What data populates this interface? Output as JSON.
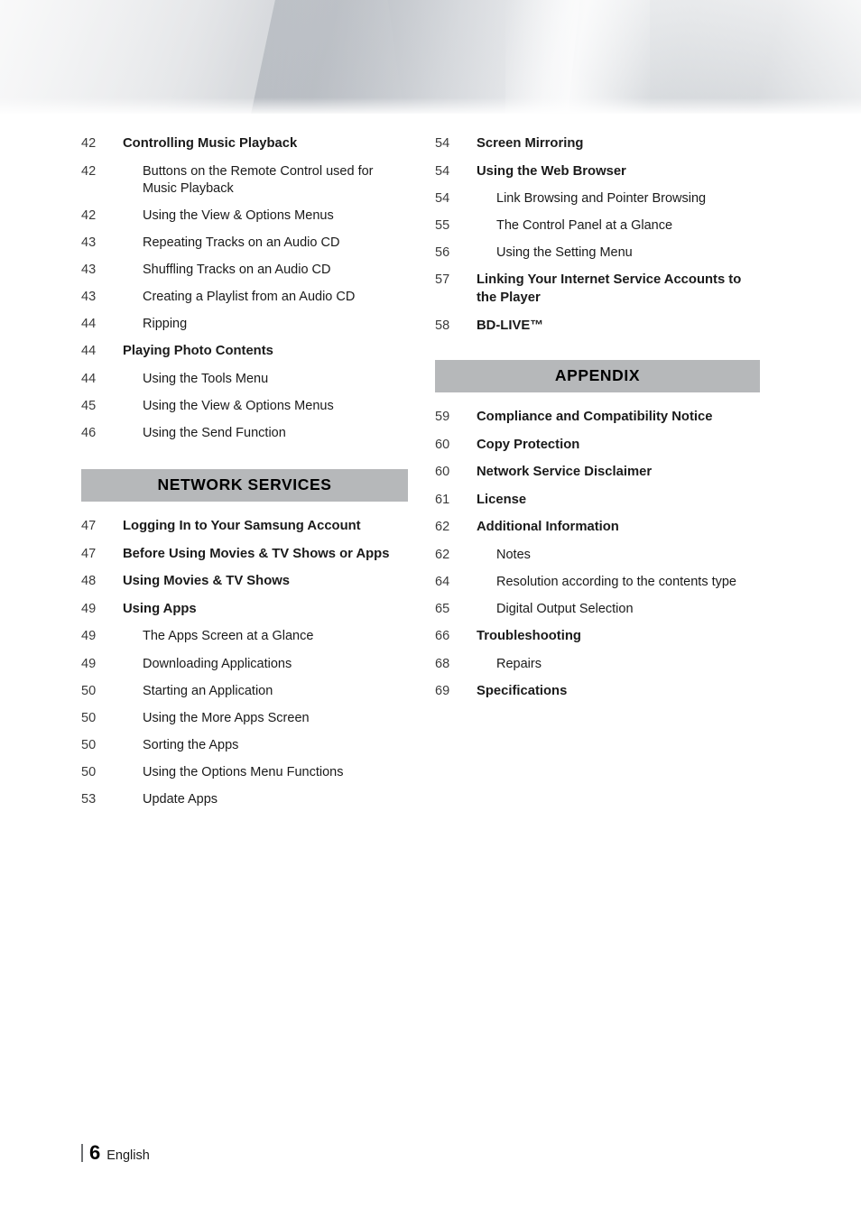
{
  "document": {
    "footer": {
      "page_number": "6",
      "language": "English"
    }
  },
  "toc": {
    "left_column": {
      "entries_top": [
        {
          "page": "42",
          "label": "Controlling Music Playback",
          "level": 1
        },
        {
          "page": "42",
          "label": "Buttons on the Remote Control used for Music Playback",
          "level": 2
        },
        {
          "page": "42",
          "label": "Using the View & Options Menus",
          "level": 2
        },
        {
          "page": "43",
          "label": "Repeating Tracks on an Audio CD",
          "level": 2
        },
        {
          "page": "43",
          "label": "Shuffling Tracks on an Audio CD",
          "level": 2
        },
        {
          "page": "43",
          "label": "Creating a Playlist from an Audio CD",
          "level": 2
        },
        {
          "page": "44",
          "label": "Ripping",
          "level": 2
        },
        {
          "page": "44",
          "label": "Playing Photo Contents",
          "level": 1
        },
        {
          "page": "44",
          "label": "Using the Tools Menu",
          "level": 2
        },
        {
          "page": "45",
          "label": "Using the View & Options Menus",
          "level": 2
        },
        {
          "page": "46",
          "label": "Using the Send Function",
          "level": 2
        }
      ],
      "section_title": "NETWORK SERVICES",
      "entries_bottom": [
        {
          "page": "47",
          "label": "Logging In to Your Samsung Account",
          "level": 1
        },
        {
          "page": "47",
          "label": "Before Using Movies & TV Shows or Apps",
          "level": 1
        },
        {
          "page": "48",
          "label": "Using Movies & TV Shows",
          "level": 1
        },
        {
          "page": "49",
          "label": "Using Apps",
          "level": 1
        },
        {
          "page": "49",
          "label": "The Apps Screen at a Glance",
          "level": 2
        },
        {
          "page": "49",
          "label": "Downloading Applications",
          "level": 2
        },
        {
          "page": "50",
          "label": "Starting an Application",
          "level": 2
        },
        {
          "page": "50",
          "label": "Using the More Apps Screen",
          "level": 2
        },
        {
          "page": "50",
          "label": "Sorting the Apps",
          "level": 2
        },
        {
          "page": "50",
          "label": "Using the Options Menu Functions",
          "level": 2
        },
        {
          "page": "53",
          "label": "Update Apps",
          "level": 2
        }
      ]
    },
    "right_column": {
      "entries_top": [
        {
          "page": "54",
          "label": "Screen Mirroring",
          "level": 1
        },
        {
          "page": "54",
          "label": "Using the Web Browser",
          "level": 1
        },
        {
          "page": "54",
          "label": "Link Browsing and Pointer Browsing",
          "level": 2
        },
        {
          "page": "55",
          "label": "The Control Panel at a Glance",
          "level": 2
        },
        {
          "page": "56",
          "label": "Using the Setting Menu",
          "level": 2
        },
        {
          "page": "57",
          "label": "Linking Your Internet Service Accounts to the Player",
          "level": 1
        },
        {
          "page": "58",
          "label": "BD-LIVE™",
          "level": 1
        }
      ],
      "section_title": "APPENDIX",
      "entries_bottom": [
        {
          "page": "59",
          "label": "Compliance and Compatibility Notice",
          "level": 1
        },
        {
          "page": "60",
          "label": "Copy Protection",
          "level": 1
        },
        {
          "page": "60",
          "label": "Network Service Disclaimer",
          "level": 1
        },
        {
          "page": "61",
          "label": "License",
          "level": 1
        },
        {
          "page": "62",
          "label": "Additional Information",
          "level": 1
        },
        {
          "page": "62",
          "label": "Notes",
          "level": 2
        },
        {
          "page": "64",
          "label": "Resolution according to the contents type",
          "level": 2
        },
        {
          "page": "65",
          "label": "Digital Output Selection",
          "level": 2
        },
        {
          "page": "66",
          "label": "Troubleshooting",
          "level": 1
        },
        {
          "page": "68",
          "label": "Repairs",
          "level": 2
        },
        {
          "page": "69",
          "label": "Specifications",
          "level": 1
        }
      ]
    }
  },
  "colors": {
    "section_header_bg": "#b6b8ba",
    "text": "#1a1a1a",
    "page_number_text": "#3a3a3a"
  }
}
